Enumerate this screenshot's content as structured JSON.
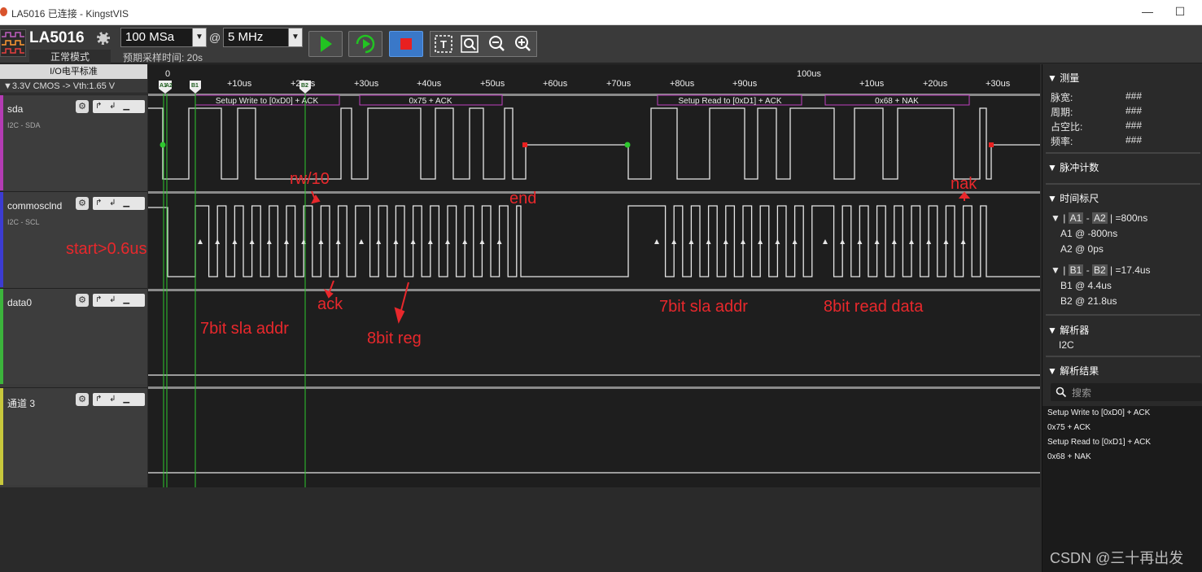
{
  "window": {
    "title": "LA5016 已连接 - KingstVIS",
    "minimize": "—",
    "maximize": "☐"
  },
  "toolbar": {
    "device_name": "LA5016",
    "device_mode": "正常模式",
    "sample_depth": "100 MSa",
    "at": "@",
    "sample_rate": "5 MHz",
    "expected_time": "预期采样时间: 20s"
  },
  "left": {
    "io_header": "I/O电平标准",
    "vth": "▼3.3V CMOS  -> Vth:1.65 V",
    "channels": [
      {
        "name": "sda",
        "sub": "I2C - SDA",
        "color": "#b43cb4"
      },
      {
        "name": "commosclnd",
        "sub": "I2C - SCL",
        "color": "#3c3cd2"
      },
      {
        "name": "data0",
        "sub": "",
        "color": "#3cb43c"
      },
      {
        "name": "通道 3",
        "sub": "",
        "color": "#c8c83c"
      }
    ],
    "trigger_glyphs": "↱ ↲ ▁"
  },
  "timeline": {
    "markers": [
      "A1",
      "A2",
      "B1",
      "B2"
    ],
    "ticks": [
      "0",
      "+10us",
      "+20us",
      "+30us",
      "+40us",
      "+50us",
      "+60us",
      "+70us",
      "+80us",
      "+90us",
      "100us",
      "+10us",
      "+20us",
      "+30us"
    ]
  },
  "decode": [
    {
      "text": "Setup Write to [0xD0] + ACK"
    },
    {
      "text": "0x75 + ACK"
    },
    {
      "text": "Setup Read to [0xD1] + ACK"
    },
    {
      "text": "0x68 + NAK"
    }
  ],
  "annotations": {
    "rw": "rw/10",
    "end": "end",
    "nak": "nak",
    "start": "start>0.6us",
    "ack": "ack",
    "sla1": "7bit sla addr",
    "reg": "8bit reg",
    "sla2": "7bit sla addr",
    "read": "8bit read data"
  },
  "right": {
    "measure_title": "测量",
    "measure_rows": [
      {
        "label": "脉宽:",
        "value": "###"
      },
      {
        "label": "周期:",
        "value": "###"
      },
      {
        "label": "占空比:",
        "value": "###"
      },
      {
        "label": "频率:",
        "value": "###"
      }
    ],
    "pulse_title": "脉冲计数",
    "ruler_title": "时间标尺",
    "ruler_a": {
      "m1": "A1",
      "m2": "A2",
      "value": "=800ns",
      "p1": "A1 @ -800ns",
      "p2": "A2 @ 0ps"
    },
    "ruler_b": {
      "m1": "B1",
      "m2": "B2",
      "value": "=17.4us",
      "p1": "B1 @ 4.4us",
      "p2": "B2 @ 21.8us"
    },
    "analyzer_title": "解析器",
    "analyzer_item": "I2C",
    "results_title": "解析结果",
    "search_placeholder": "搜索",
    "results": [
      "Setup Write to [0xD0] + ACK",
      "0x75 + ACK",
      "Setup Read to [0xD1] + ACK",
      "0x68 + NAK"
    ]
  },
  "watermark": "CSDN @三十再出发"
}
